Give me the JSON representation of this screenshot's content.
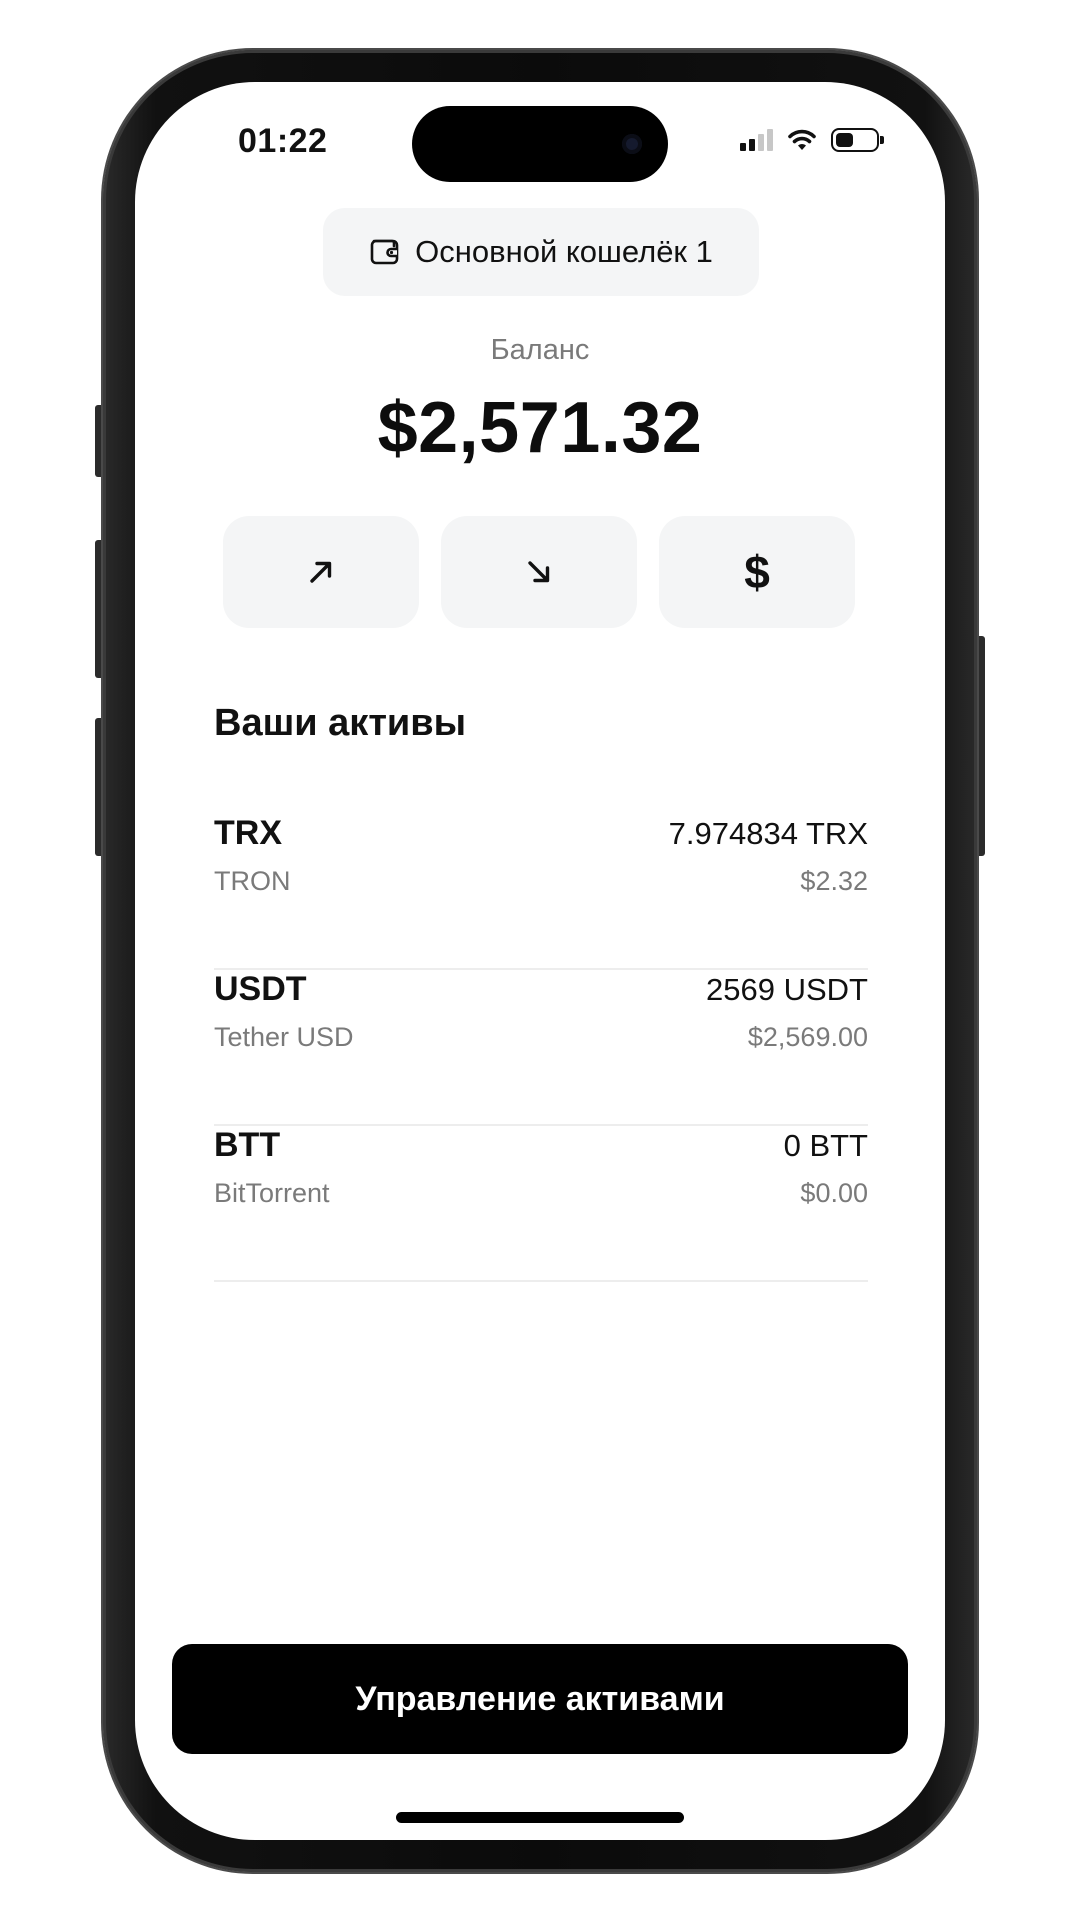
{
  "status_bar": {
    "time": "01:22",
    "signal_bars_active": 2,
    "signal_bars_total": 4,
    "wifi_icon": "wifi-icon",
    "battery_level": 0.45
  },
  "wallet": {
    "icon": "wallet-icon",
    "name": "Основной кошелёк 1"
  },
  "balance": {
    "label": "Баланс",
    "amount": "$2,571.32"
  },
  "actions": [
    {
      "icon": "send-arrow-up-right-icon"
    },
    {
      "icon": "receive-arrow-down-right-icon"
    },
    {
      "icon": "dollar-icon",
      "glyph": "$"
    }
  ],
  "assets": {
    "heading": "Ваши активы",
    "items": [
      {
        "symbol": "TRX",
        "name": "TRON",
        "balance": "7.974834 TRX",
        "fiat": "$2.32"
      },
      {
        "symbol": "USDT",
        "name": "Tether USD",
        "balance": "2569 USDT",
        "fiat": "$2,569.00"
      },
      {
        "symbol": "BTT",
        "name": "BitTorrent",
        "balance": "0 BTT",
        "fiat": "$0.00"
      }
    ]
  },
  "cta": {
    "label": "Управление активами"
  },
  "colors": {
    "accent": "#000000",
    "surface": "#f4f5f6",
    "muted_text": "#7a7a7a",
    "divider": "#ededed"
  }
}
